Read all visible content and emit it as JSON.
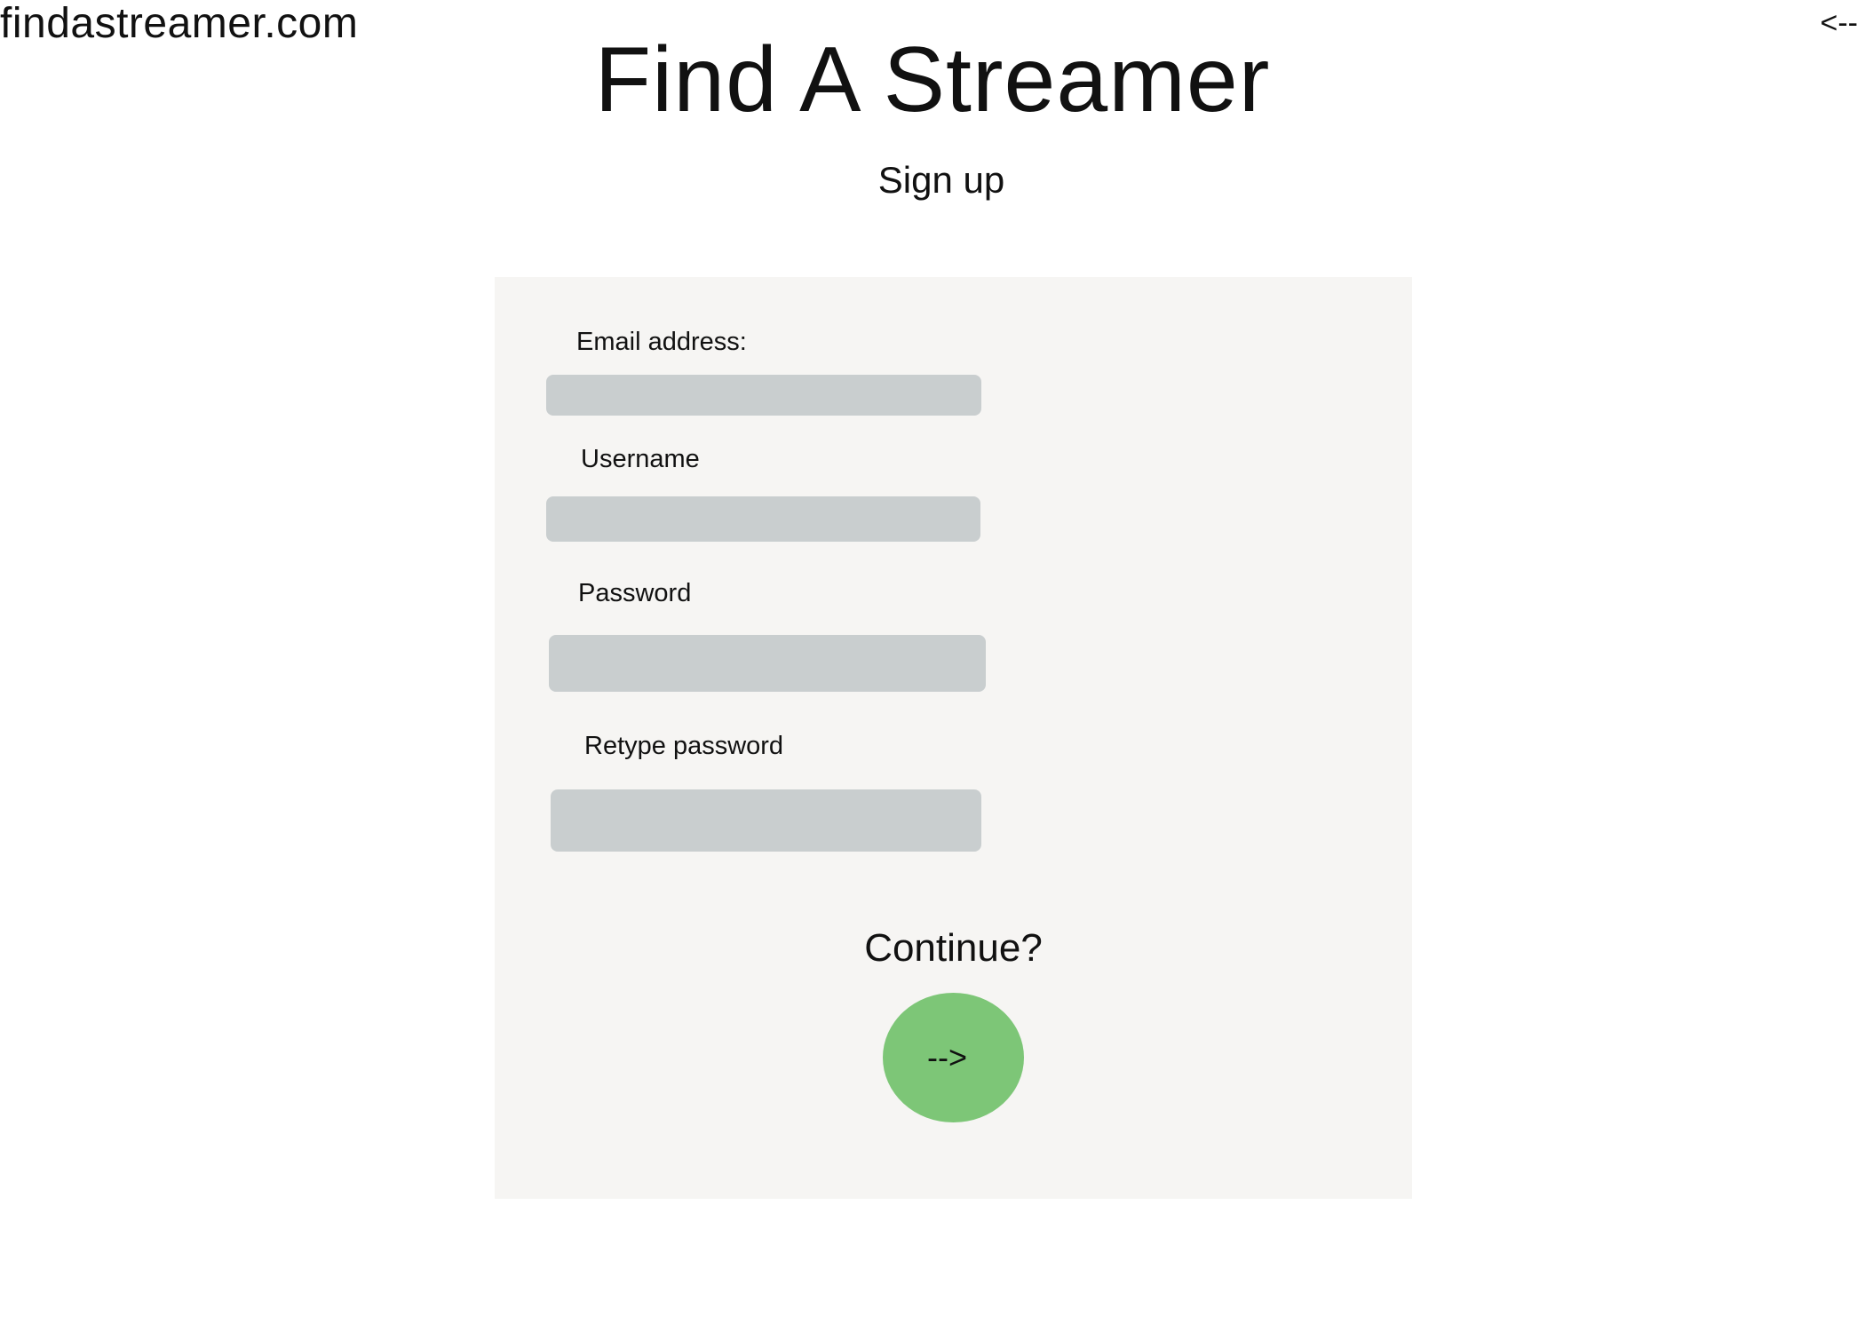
{
  "header": {
    "site_url": "findastreamer.com",
    "back_label": "<--",
    "title": "Find A Streamer",
    "subtitle": "Sign up"
  },
  "form": {
    "fields": [
      {
        "label": "Email address:",
        "value": "",
        "placeholder": ""
      },
      {
        "label": "Username",
        "value": "",
        "placeholder": ""
      },
      {
        "label": "Password",
        "value": "",
        "placeholder": ""
      },
      {
        "label": "Retype password",
        "value": "",
        "placeholder": ""
      }
    ],
    "continue_label": "Continue?",
    "continue_button_label": "-->"
  },
  "colors": {
    "panel_background": "#f6f5f3",
    "input_background": "#c9cecf",
    "continue_button": "#7dc677"
  }
}
